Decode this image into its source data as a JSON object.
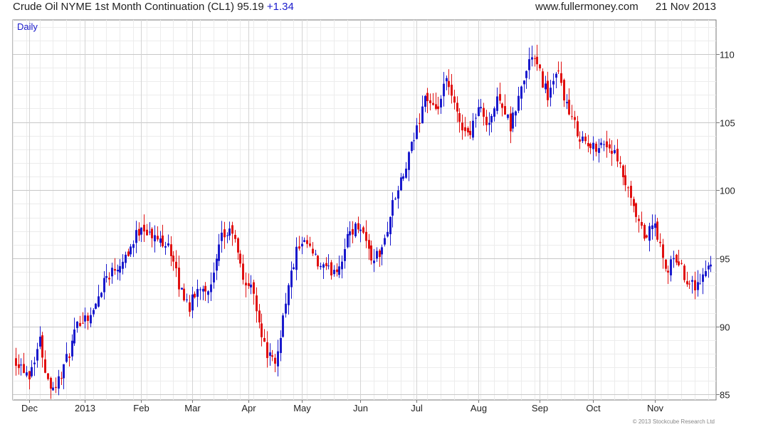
{
  "header": {
    "title": "Crude Oil NYME 1st Month Continuation (CL1) 95.19",
    "change": "+1.34",
    "website": "www.fullermoney.com",
    "date": "21 Nov 2013"
  },
  "footer": {
    "copyright": "© 2013 Stockcube Research Ltd"
  },
  "colors": {
    "up": "#1a1acc",
    "down": "#e01010",
    "grid": "#d9d9d9",
    "axis": "#777777"
  },
  "chart_data": {
    "type": "candlestick",
    "period_label": "Daily",
    "x_tick_labels": [
      "Dec",
      "2013",
      "Feb",
      "Mar",
      "Apr",
      "May",
      "Jun",
      "Jul",
      "Aug",
      "Sep",
      "Oct",
      "Nov"
    ],
    "x_tick_days": [
      0,
      21,
      42,
      61,
      82,
      102,
      124,
      145,
      168,
      191,
      211,
      234
    ],
    "y_tick_labels": [
      "85",
      "90",
      "95",
      "100",
      "105",
      "110"
    ],
    "y_ticks": [
      85,
      90,
      95,
      100,
      105,
      110
    ],
    "ylim": [
      84.6,
      112.5
    ],
    "xlim_days": [
      -6,
      257
    ],
    "grid": true,
    "path_days": [
      -6,
      0,
      4,
      7,
      10,
      14,
      19,
      24,
      28,
      33,
      38,
      42,
      46,
      52,
      56,
      60,
      64,
      68,
      72,
      76,
      80,
      84,
      88,
      92,
      96,
      100,
      104,
      108,
      112,
      116,
      120,
      124,
      128,
      132,
      136,
      140,
      145,
      148,
      152,
      156,
      160,
      164,
      168,
      172,
      176,
      180,
      184,
      188,
      190,
      194,
      198,
      202,
      206,
      210,
      214,
      218,
      222,
      226,
      230,
      234,
      238,
      242,
      246,
      250,
      253,
      256
    ],
    "path_closes": [
      87.8,
      86.5,
      89.0,
      86.0,
      85.6,
      87.5,
      90.5,
      91.0,
      93.5,
      94.5,
      95.8,
      97.5,
      96.5,
      96.2,
      93.0,
      91.5,
      93.0,
      92.8,
      96.5,
      97.0,
      93.5,
      92.5,
      88.5,
      87.0,
      92.0,
      95.5,
      96.0,
      94.5,
      94.0,
      94.5,
      97.0,
      97.5,
      95.0,
      95.5,
      99.0,
      101.0,
      104.5,
      107.0,
      105.5,
      108.0,
      105.5,
      104.0,
      106.0,
      105.0,
      107.0,
      104.5,
      107.5,
      110.0,
      109.0,
      107.0,
      108.5,
      105.5,
      104.0,
      103.0,
      103.5,
      103.0,
      101.0,
      98.5,
      96.5,
      97.5,
      94.0,
      95.0,
      93.5,
      93.0,
      94.0,
      95.2
    ]
  }
}
